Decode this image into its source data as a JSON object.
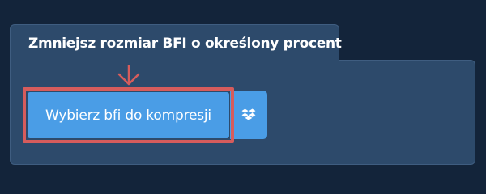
{
  "tab": {
    "title": "Zmniejsz rozmiar BFI o określony procent"
  },
  "upload": {
    "button_label": "Wybierz bfi do kompresji"
  },
  "icons": {
    "arrow": "arrow-down-icon",
    "dropbox": "dropbox-icon"
  },
  "colors": {
    "background": "#13243a",
    "panel": "#2d4a6b",
    "button": "#4a9de6",
    "highlight": "#d65c5c"
  }
}
